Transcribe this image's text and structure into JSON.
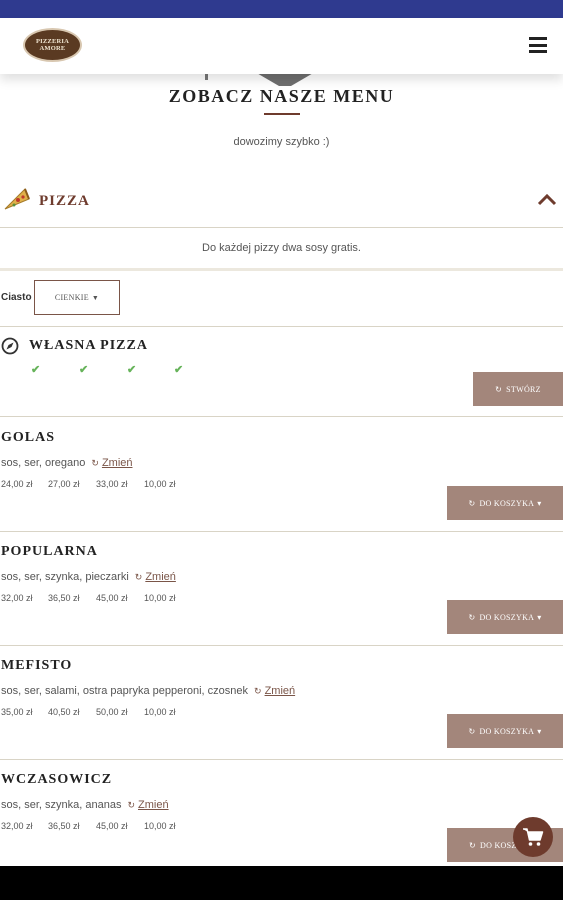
{
  "header": {
    "logo_text": "PIZZERIA AMORE",
    "menu_icon": "hamburger-icon"
  },
  "menu_section": {
    "title": "ZOBACZ NASZE MENU",
    "tagline": "dowozimy szybko :)"
  },
  "category": {
    "label": "PIZZA",
    "icon": "pizza-slice-icon",
    "toggle_icon": "chevron-up-icon",
    "info": "Do każdej pizzy dwa sosy gratis."
  },
  "dough": {
    "label": "Ciasto",
    "selected": "CIENKIE"
  },
  "custom_pizza": {
    "title": "WŁASNA PIZZA",
    "icon": "compass-icon",
    "button_label": "STWÓRZ"
  },
  "pizzas": [
    {
      "name": "GOLAS",
      "desc": "sos, ser, oregano",
      "change_label": "Zmień",
      "prices": [
        "24,00 zł",
        "27,00 zł",
        "33,00 zł",
        "10,00 zł"
      ],
      "button_label": "DO KOSZYKA"
    },
    {
      "name": "POPULARNA",
      "desc": "sos, ser, szynka, pieczarki",
      "change_label": "Zmień",
      "prices": [
        "32,00 zł",
        "36,50 zł",
        "45,00 zł",
        "10,00 zł"
      ],
      "button_label": "DO KOSZYKA"
    },
    {
      "name": "MEFISTO",
      "desc": "sos, ser, salami, ostra papryka pepperoni, czosnek",
      "change_label": "Zmień",
      "prices": [
        "35,00 zł",
        "40,50 zł",
        "50,00 zł",
        "10,00 zł"
      ],
      "button_label": "DO KOSZYKA"
    },
    {
      "name": "WCZASOWICZ",
      "desc": "sos, ser, szynka, ananas",
      "change_label": "Zmień",
      "prices": [
        "32,00 zł",
        "36,50 zł",
        "45,00 zł",
        "10,00 zł"
      ],
      "button_label": "DO KOSZ"
    }
  ],
  "colors": {
    "status_bar": "#2f3a8f",
    "accent": "#6e3b2d",
    "button": "#a3867b",
    "check": "#66b35a"
  }
}
